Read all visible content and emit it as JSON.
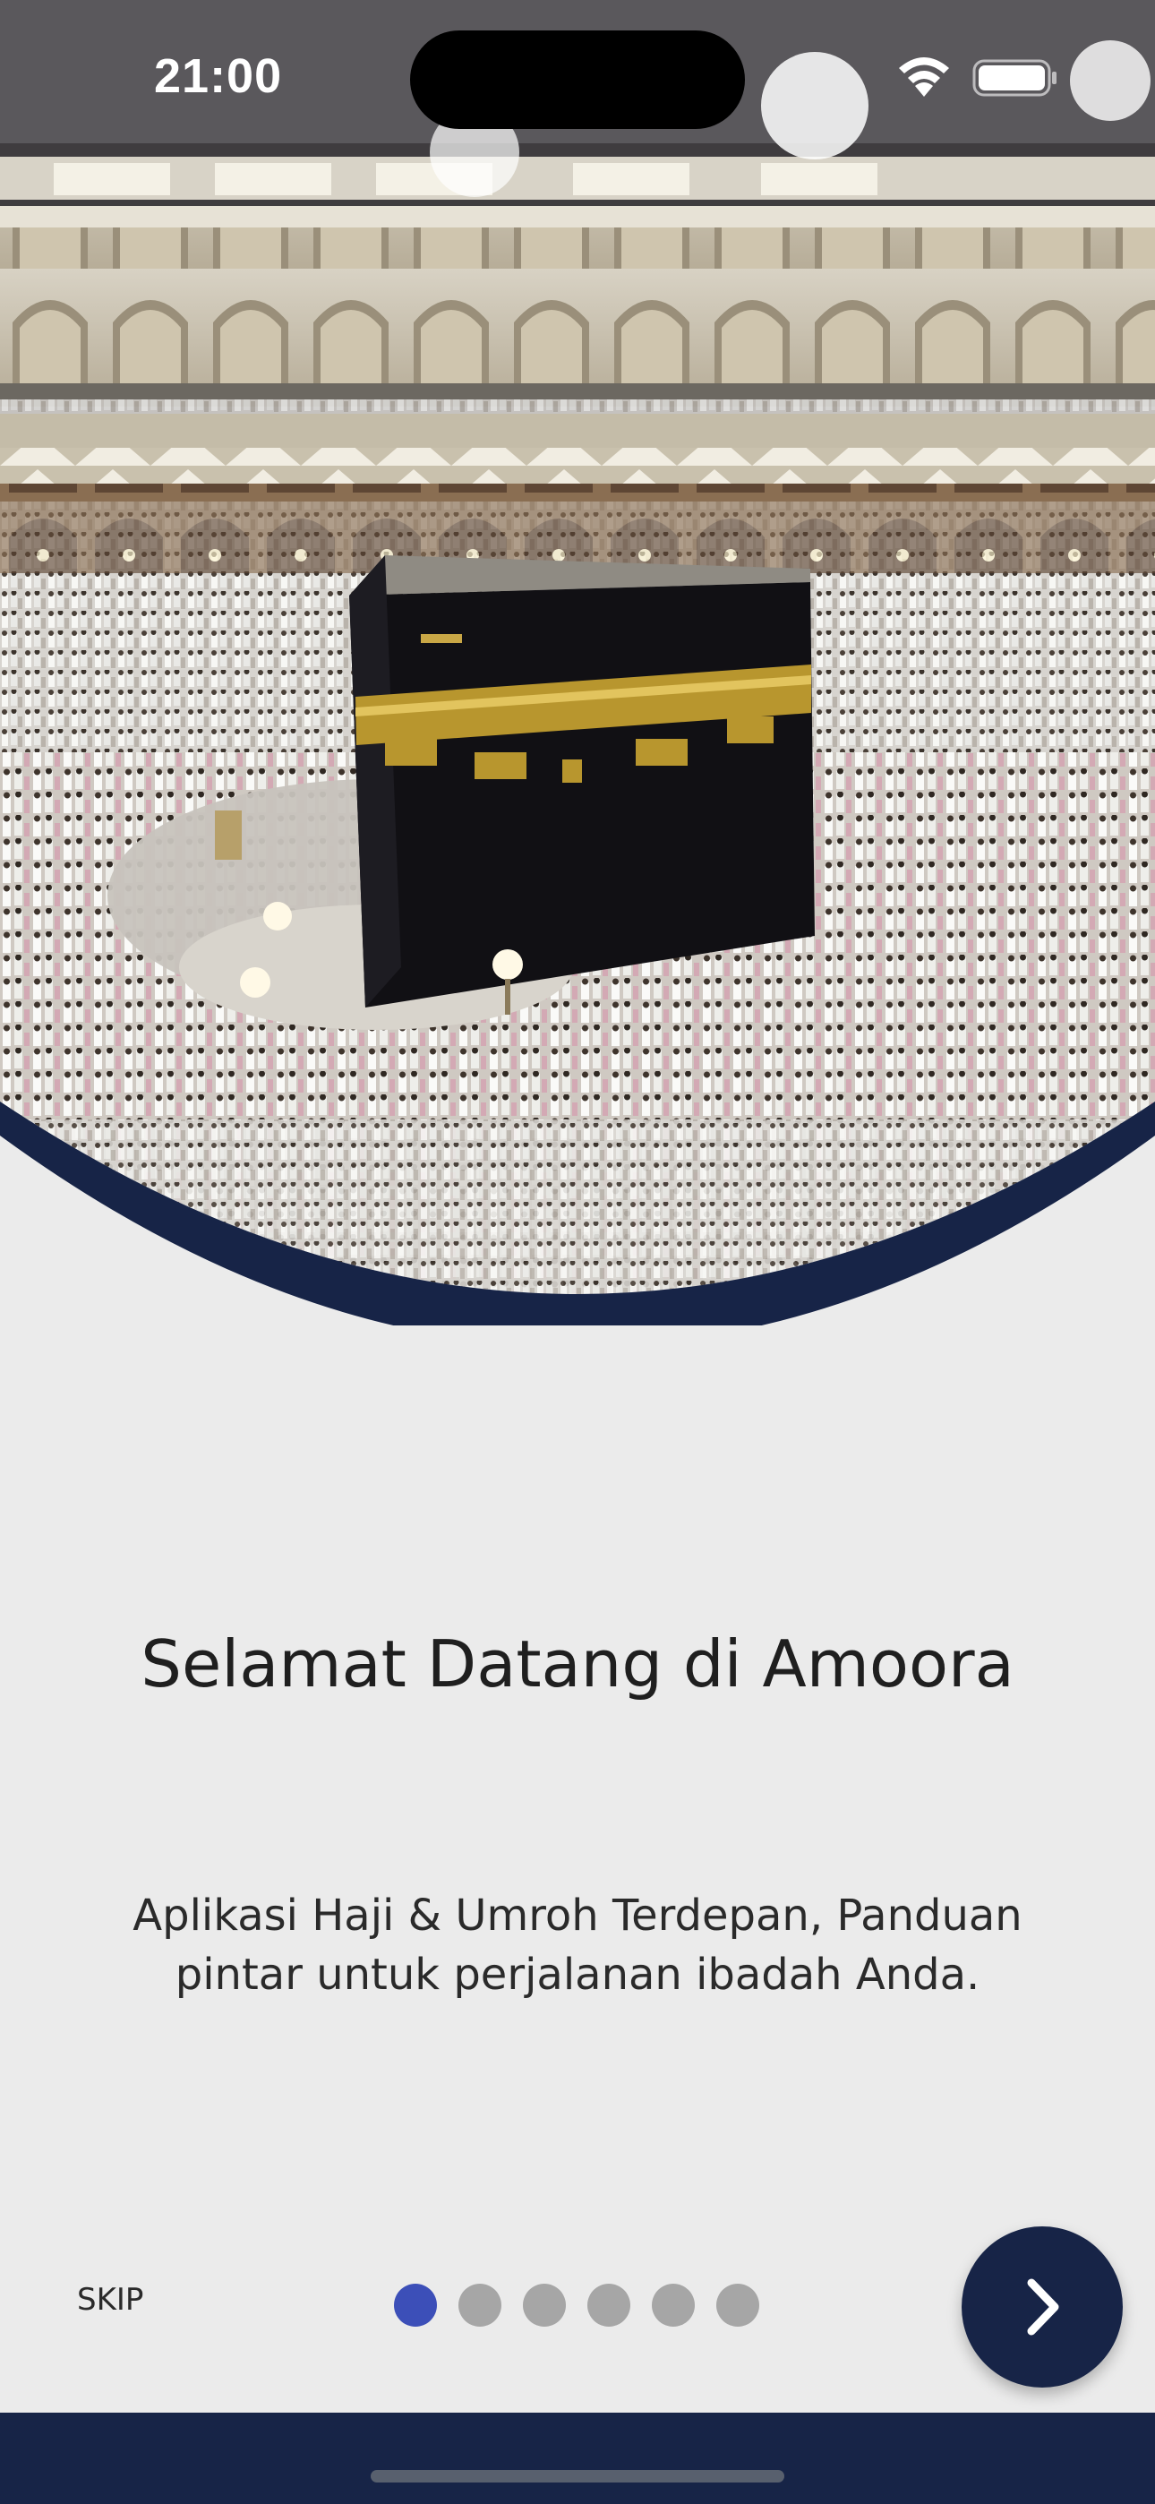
{
  "status_bar": {
    "time": "21:00",
    "wifi_icon": "wifi-icon",
    "battery_icon": "battery-icon"
  },
  "hero": {
    "image": "kaaba-mecca-photo",
    "accent_color": "#172447"
  },
  "onboarding": {
    "title": "Selamat Datang di Amoora",
    "subtitle": "Aplikasi Haji & Umroh Terdepan, Panduan pintar untuk perjalanan ibadah Anda.",
    "skip_label": "SKIP",
    "next_icon": "chevron-right-icon",
    "page_count": 6,
    "active_page": 1,
    "active_dot_color": "#3c4fb8",
    "inactive_dot_color": "#a6a6a6"
  }
}
